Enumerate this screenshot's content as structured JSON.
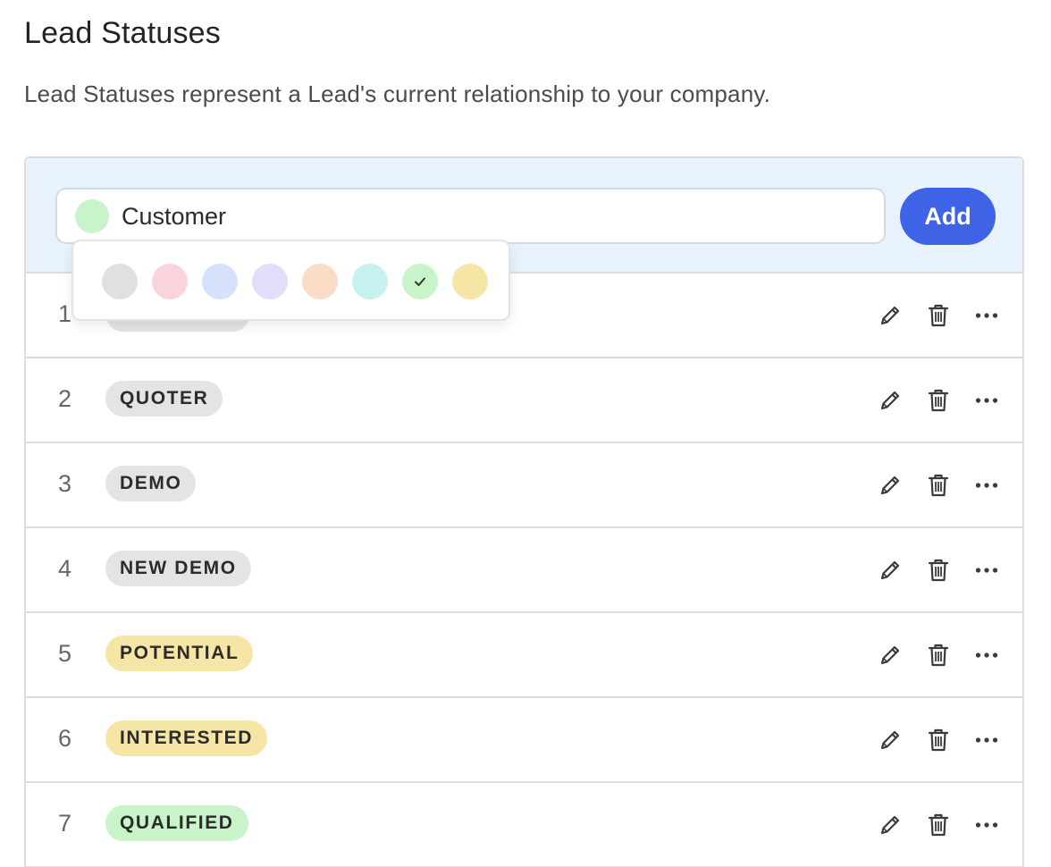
{
  "page": {
    "title": "Lead Statuses",
    "subtitle": "Lead Statuses represent a Lead's current relationship to your company."
  },
  "new_status": {
    "value": "Customer",
    "selected_color": "#c9f3c8",
    "add_label": "Add"
  },
  "color_picker": {
    "options": [
      {
        "name": "gray",
        "color": "#e0e0e0",
        "selected": false
      },
      {
        "name": "pink",
        "color": "#fad4dd",
        "selected": false
      },
      {
        "name": "blue",
        "color": "#d6e2fb",
        "selected": false
      },
      {
        "name": "purple",
        "color": "#e4dcfb",
        "selected": false
      },
      {
        "name": "orange",
        "color": "#fbdcc6",
        "selected": false
      },
      {
        "name": "cyan",
        "color": "#c5f1f1",
        "selected": false
      },
      {
        "name": "green",
        "color": "#c9f3c8",
        "selected": true
      },
      {
        "name": "yellow",
        "color": "#f6e6a6",
        "selected": false
      }
    ],
    "check_icon": "check-icon"
  },
  "statuses": [
    {
      "num": "1",
      "label": "",
      "color": "#e4e4e4"
    },
    {
      "num": "2",
      "label": "QUOTER",
      "color": "#e4e4e4"
    },
    {
      "num": "3",
      "label": "DEMO",
      "color": "#e4e4e4"
    },
    {
      "num": "4",
      "label": "NEW DEMO",
      "color": "#e4e4e4"
    },
    {
      "num": "5",
      "label": "POTENTIAL",
      "color": "#f6e6a6"
    },
    {
      "num": "6",
      "label": "INTERESTED",
      "color": "#f6e6a6"
    },
    {
      "num": "7",
      "label": "QUALIFIED",
      "color": "#c9f3c8"
    }
  ],
  "row_actions": {
    "edit_icon": "pencil-icon",
    "delete_icon": "trash-icon",
    "more_icon": "more-dots-icon"
  }
}
